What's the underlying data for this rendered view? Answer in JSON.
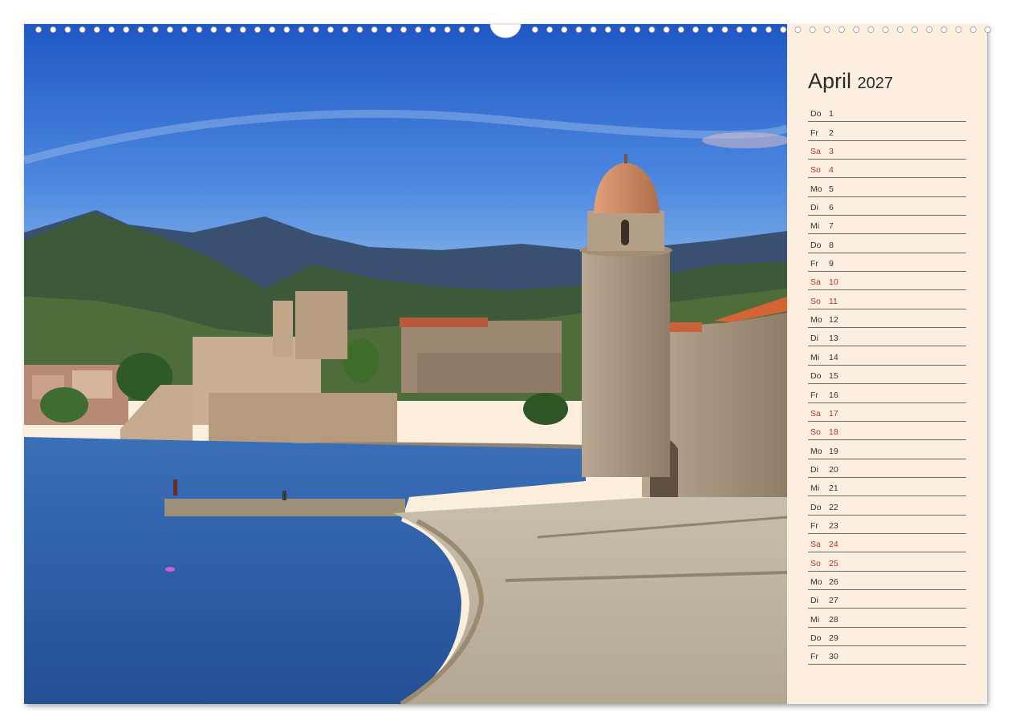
{
  "calendar": {
    "month": "April",
    "year": "2027",
    "days": [
      {
        "dow": "Do",
        "num": "1",
        "weekend": false
      },
      {
        "dow": "Fr",
        "num": "2",
        "weekend": false
      },
      {
        "dow": "Sa",
        "num": "3",
        "weekend": true
      },
      {
        "dow": "So",
        "num": "4",
        "weekend": true
      },
      {
        "dow": "Mo",
        "num": "5",
        "weekend": false
      },
      {
        "dow": "Di",
        "num": "6",
        "weekend": false
      },
      {
        "dow": "Mi",
        "num": "7",
        "weekend": false
      },
      {
        "dow": "Do",
        "num": "8",
        "weekend": false
      },
      {
        "dow": "Fr",
        "num": "9",
        "weekend": false
      },
      {
        "dow": "Sa",
        "num": "10",
        "weekend": true
      },
      {
        "dow": "So",
        "num": "11",
        "weekend": true
      },
      {
        "dow": "Mo",
        "num": "12",
        "weekend": false
      },
      {
        "dow": "Di",
        "num": "13",
        "weekend": false
      },
      {
        "dow": "Mi",
        "num": "14",
        "weekend": false
      },
      {
        "dow": "Do",
        "num": "15",
        "weekend": false
      },
      {
        "dow": "Fr",
        "num": "16",
        "weekend": false
      },
      {
        "dow": "Sa",
        "num": "17",
        "weekend": true
      },
      {
        "dow": "So",
        "num": "18",
        "weekend": true
      },
      {
        "dow": "Mo",
        "num": "19",
        "weekend": false
      },
      {
        "dow": "Di",
        "num": "20",
        "weekend": false
      },
      {
        "dow": "Mi",
        "num": "21",
        "weekend": false
      },
      {
        "dow": "Do",
        "num": "22",
        "weekend": false
      },
      {
        "dow": "Fr",
        "num": "23",
        "weekend": false
      },
      {
        "dow": "Sa",
        "num": "24",
        "weekend": true
      },
      {
        "dow": "So",
        "num": "25",
        "weekend": true
      },
      {
        "dow": "Mo",
        "num": "26",
        "weekend": false
      },
      {
        "dow": "Di",
        "num": "27",
        "weekend": false
      },
      {
        "dow": "Mi",
        "num": "28",
        "weekend": false
      },
      {
        "dow": "Do",
        "num": "29",
        "weekend": false
      },
      {
        "dow": "Fr",
        "num": "30",
        "weekend": false
      }
    ]
  },
  "colors": {
    "weekend_text": "#b0352e",
    "weekday_text": "#333333",
    "panel_background": "#fcefdf",
    "sky": "#2f6fd0",
    "sea": "#2c5fa8"
  }
}
